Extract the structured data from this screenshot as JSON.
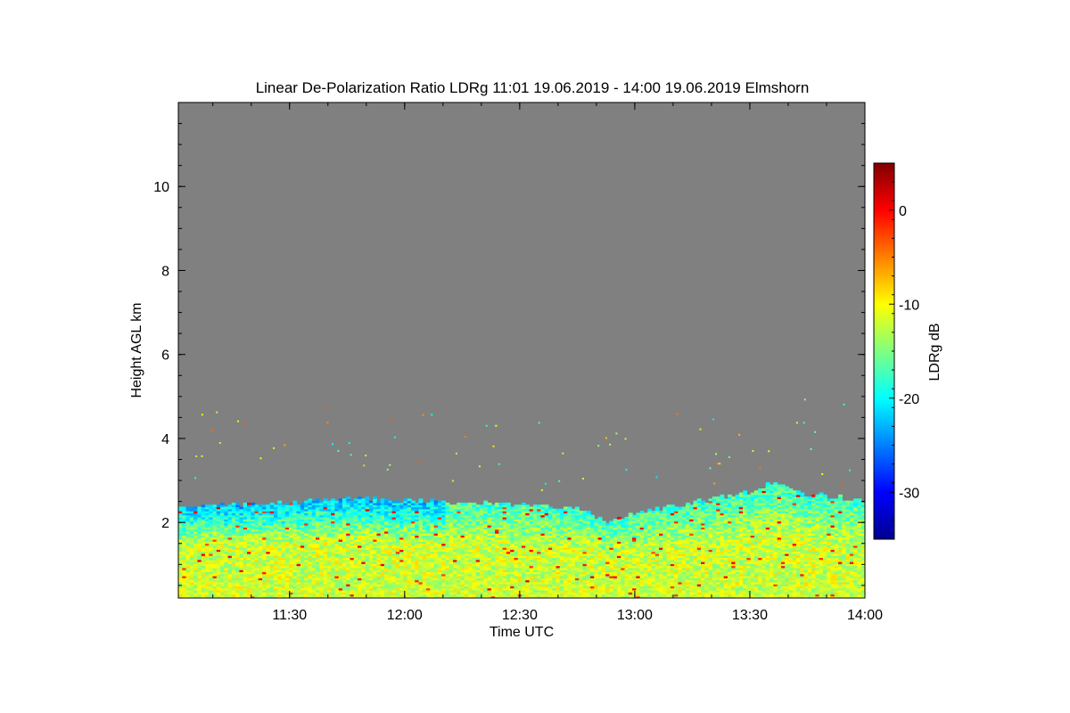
{
  "chart_data": {
    "type": "heatmap",
    "title": "Linear De-Polarization Ratio LDRg   11:01 19.06.2019 - 14:00 19.06.2019 Elmshorn",
    "xlabel": "Time UTC",
    "ylabel": "Height AGL km",
    "colorbar_label": "LDRg dB",
    "x_time_range_utc": [
      "11:01",
      "14:00"
    ],
    "x_ticks": [
      {
        "value": "11:30",
        "label": "11:30"
      },
      {
        "value": "12:00",
        "label": "12:00"
      },
      {
        "value": "12:30",
        "label": "12:30"
      },
      {
        "value": "13:00",
        "label": "13:00"
      },
      {
        "value": "13:30",
        "label": "13:30"
      },
      {
        "value": "14:00",
        "label": "14:00"
      }
    ],
    "ylim": [
      0.2,
      12
    ],
    "y_ticks": [
      2,
      4,
      6,
      8,
      10
    ],
    "colorbar_range": [
      -35,
      5
    ],
    "colorbar_ticks": [
      0,
      -10,
      -20,
      -30
    ],
    "colormap": "jet",
    "no_signal_color": "#808080",
    "cloud_top_profile": [
      {
        "time": "11:01",
        "height_km": 2.35
      },
      {
        "time": "11:15",
        "height_km": 2.4
      },
      {
        "time": "11:30",
        "height_km": 2.45
      },
      {
        "time": "11:45",
        "height_km": 2.55
      },
      {
        "time": "12:00",
        "height_km": 2.5
      },
      {
        "time": "12:15",
        "height_km": 2.45
      },
      {
        "time": "12:30",
        "height_km": 2.4
      },
      {
        "time": "12:45",
        "height_km": 2.35
      },
      {
        "time": "12:53",
        "height_km": 2.0
      },
      {
        "time": "13:00",
        "height_km": 2.2
      },
      {
        "time": "13:15",
        "height_km": 2.45
      },
      {
        "time": "13:30",
        "height_km": 2.7
      },
      {
        "time": "13:36",
        "height_km": 2.95
      },
      {
        "time": "13:45",
        "height_km": 2.65
      },
      {
        "time": "14:00",
        "height_km": 2.5
      }
    ],
    "typical_ldr_db": {
      "lower_layer": -12,
      "upper_layer": -20
    }
  }
}
